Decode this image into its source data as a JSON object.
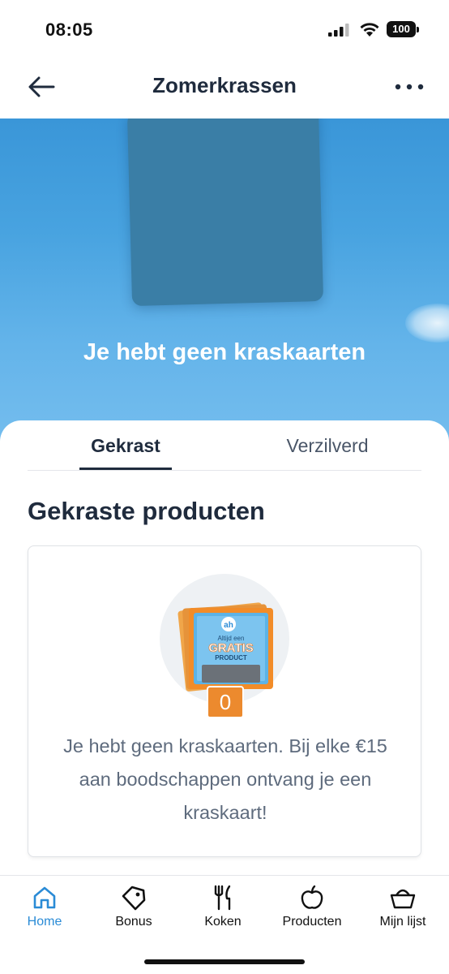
{
  "status_bar": {
    "time": "08:05",
    "battery": "100"
  },
  "nav": {
    "title": "Zomerkrassen"
  },
  "hero": {
    "message": "Je hebt geen kraskaarten"
  },
  "tabs": [
    {
      "label": "Gekrast",
      "active": true
    },
    {
      "label": "Verzilverd",
      "active": false
    }
  ],
  "section": {
    "title": "Gekraste producten"
  },
  "empty_state": {
    "card_line1": "Altijd een",
    "card_line2": "GRATIS",
    "card_line3": "PRODUCT",
    "count": "0",
    "message": "Je hebt geen kraskaarten. Bij elke €15 aan boodschappen ontvang je een kraskaart!"
  },
  "bottom_nav": [
    {
      "label": "Home",
      "icon": "home-icon",
      "active": true
    },
    {
      "label": "Bonus",
      "icon": "tag-icon",
      "active": false
    },
    {
      "label": "Koken",
      "icon": "cutlery-icon",
      "active": false
    },
    {
      "label": "Producten",
      "icon": "apple-icon",
      "active": false
    },
    {
      "label": "Mijn lijst",
      "icon": "basket-icon",
      "active": false
    }
  ],
  "colors": {
    "accent": "#2a8bd6",
    "text_dark": "#1f2b3d",
    "badge_orange": "#ec8a2e",
    "hero_blue": "#48a3e0"
  }
}
